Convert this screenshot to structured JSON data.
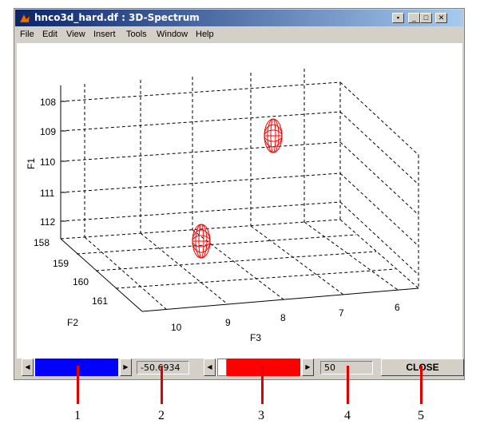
{
  "window": {
    "title": "hnco3d_hard.df : 3D-Spectrum",
    "controls": [
      "pin",
      "minimize",
      "maximize",
      "close"
    ]
  },
  "menu": [
    "File",
    "Edit",
    "View",
    "Insert",
    "Tools",
    "Window",
    "Help"
  ],
  "plot": {
    "axes": {
      "F1": "F1",
      "F2": "F2",
      "F3": "F3"
    },
    "f1_ticks": [
      "108",
      "109",
      "110",
      "111",
      "112"
    ],
    "f2_ticks": [
      "158",
      "159",
      "160",
      "161"
    ],
    "f3_ticks": [
      "10",
      "9",
      "8",
      "7",
      "6"
    ],
    "peak_color": "#ff0000"
  },
  "controls": {
    "slider1": {
      "color": "#0000ff",
      "left_arrow": "◀",
      "right_arrow": "▶",
      "value": 1.0
    },
    "value1": "-50.6934",
    "slider2": {
      "color": "#ff0000",
      "left_arrow": "◀",
      "right_arrow": "▶",
      "value": 0.0
    },
    "value2": "50",
    "close_label": "CLOSE"
  },
  "callouts": [
    "1",
    "2",
    "3",
    "4",
    "5"
  ]
}
